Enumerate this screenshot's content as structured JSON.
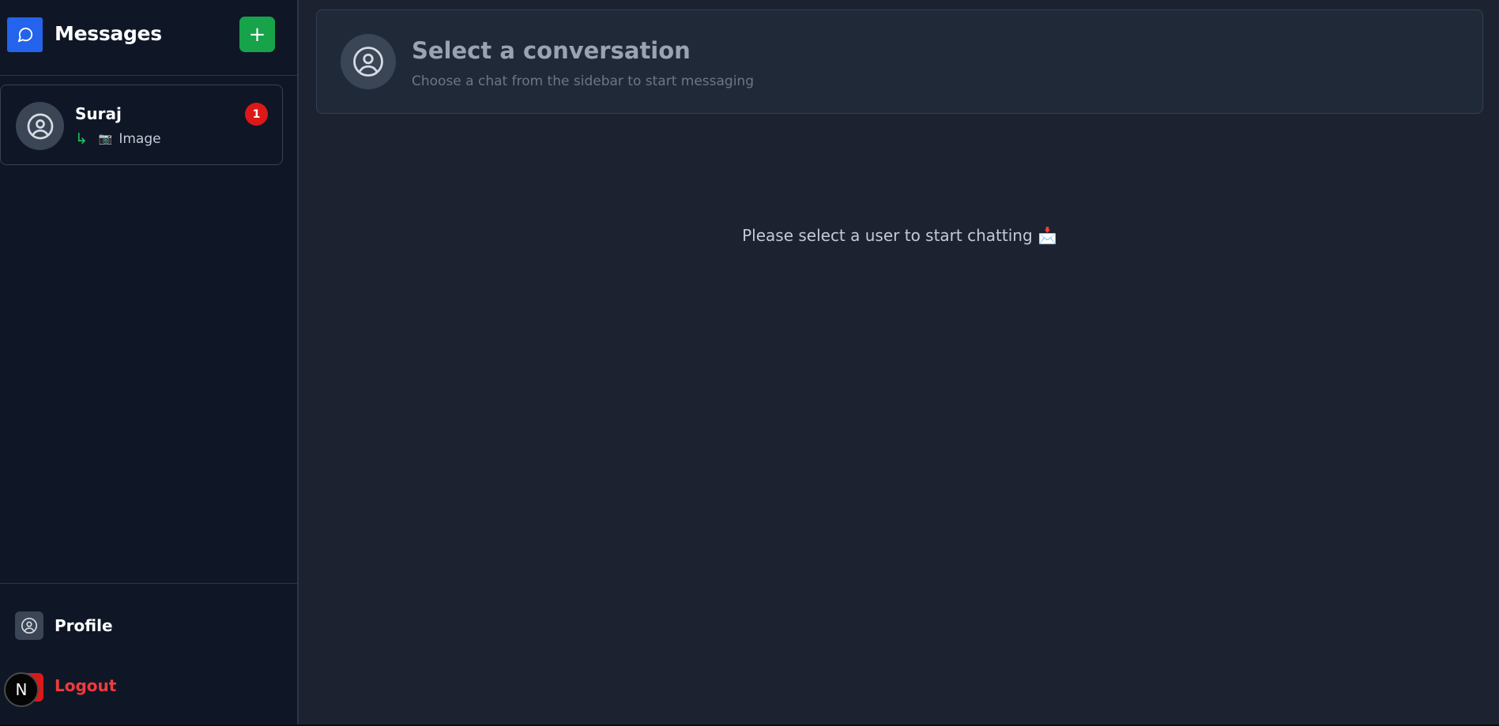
{
  "sidebar": {
    "logo_icon": "chat-bubble-icon",
    "title": "Messages",
    "new_chat_label": "+",
    "new_chat_icon": "plus-icon",
    "conversations": [
      {
        "name": "Suraj",
        "unread_count": "1",
        "preview_arrow": "↳",
        "preview_icon": "📷",
        "preview_text": "Image",
        "avatar_icon": "user-circle-icon"
      }
    ],
    "footer": {
      "profile_label": "Profile",
      "profile_icon": "user-circle-icon",
      "logout_label": "Logout",
      "logout_icon": "logout-icon",
      "overlay_badge": "N"
    }
  },
  "main": {
    "header": {
      "title": "Select a conversation",
      "subtitle": "Choose a chat from the sidebar to start messaging",
      "avatar_icon": "user-circle-icon"
    },
    "empty_state": "Please select a user to start chatting 📩"
  },
  "colors": {
    "accent_blue": "#2463eb",
    "new_button_green": "#16a34a",
    "badge_red": "#dc1818",
    "logout_red": "#ef3b3b",
    "sidebar_bg": "#0f1727",
    "main_bg": "#1d2231"
  }
}
